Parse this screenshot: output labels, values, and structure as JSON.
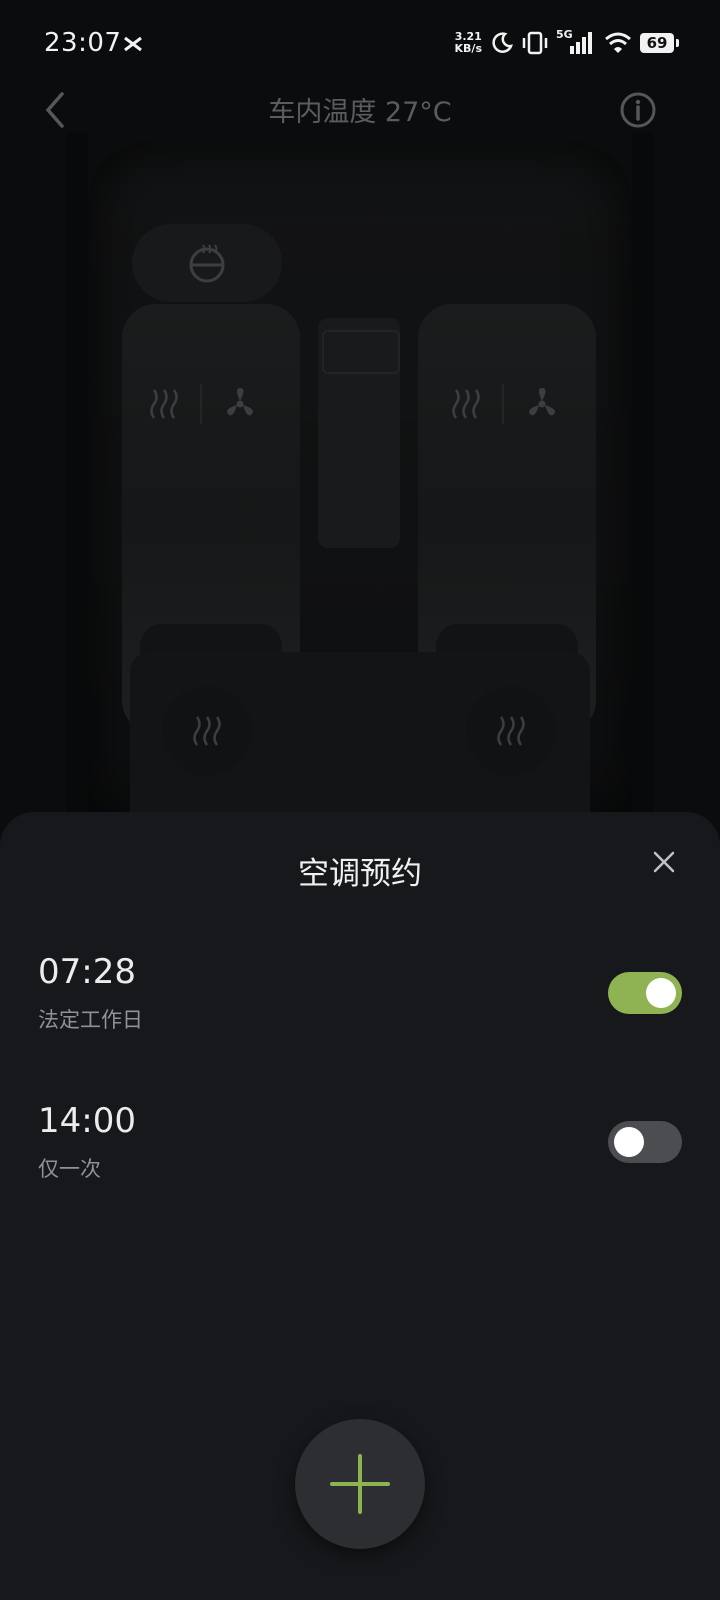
{
  "status_bar": {
    "time": "23:07",
    "net_speed_value": "3.21",
    "net_speed_unit": "KB/s",
    "network": "5G",
    "battery": "69",
    "icons": [
      "cross-notification-icon",
      "moon-icon",
      "vibrate-icon",
      "signal-icon",
      "wifi-icon",
      "battery-icon"
    ]
  },
  "header": {
    "title": "车内温度 27°C",
    "back_icon": "chevron-left-icon",
    "info_icon": "info-icon"
  },
  "car_controls": {
    "steering_wheel_icon": "steering-wheel-heat-icon",
    "front_left": [
      "seat-heat-icon",
      "fan-icon"
    ],
    "front_right": [
      "seat-heat-icon",
      "fan-icon"
    ],
    "rear_left": "seat-heat-icon",
    "rear_right": "seat-heat-icon"
  },
  "sheet": {
    "title": "空调预约",
    "close_icon": "close-icon",
    "schedules": [
      {
        "time": "07:28",
        "repeat": "法定工作日",
        "enabled": true
      },
      {
        "time": "14:00",
        "repeat": "仅一次",
        "enabled": false
      }
    ],
    "add_icon": "plus-icon"
  },
  "colors": {
    "accent": "#8fb252",
    "sheet_bg": "#16181b",
    "background": "#0b0c0d"
  }
}
